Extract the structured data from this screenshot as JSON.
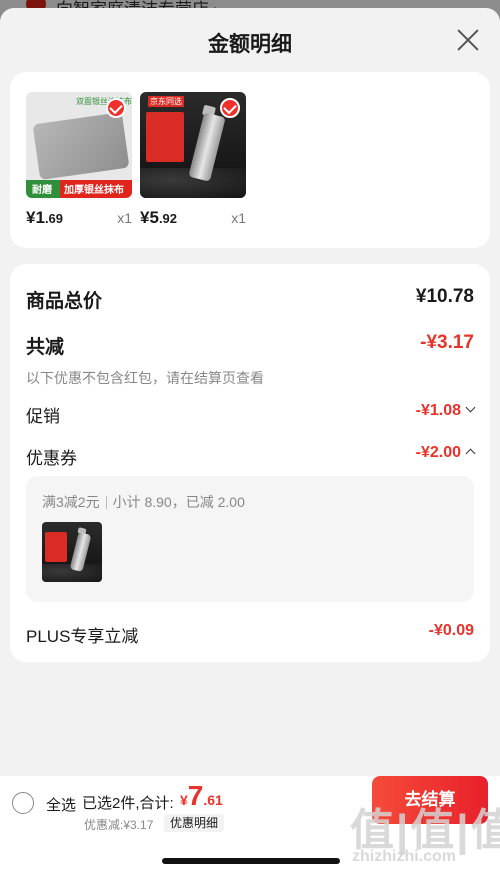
{
  "backdrop": {
    "shop_name": "向智家庭清洁专营店 ›"
  },
  "sheet": {
    "title": "金额明细",
    "close_icon": "close-icon"
  },
  "products": [
    {
      "thumb_tag_left": "耐磨",
      "thumb_tag_right": "加厚银丝抹布",
      "thumb_top_text": "双面银丝清洁布",
      "price_currency": "¥",
      "price_int": "1",
      "price_dec": ".69",
      "qty": "x1",
      "selected": true
    },
    {
      "thumb_top_tag": "京东同选",
      "price_currency": "¥",
      "price_int": "5",
      "price_dec": ".92",
      "qty": "x1",
      "selected": true
    }
  ],
  "summary": {
    "total_label": "商品总价",
    "total_value": "¥10.78",
    "reduce_label": "共减",
    "reduce_value": "-¥3.17",
    "note": "以下优惠不包含红包，请在结算页查看",
    "promo_label": "促销",
    "promo_value": "-¥1.08",
    "coupon_label": "优惠券",
    "coupon_value": "-¥2.00",
    "coupon_detail_rule": "满3减2元",
    "coupon_detail_sub": "小计 8.90，已减 2.00",
    "plus_label": "PLUS专享立减",
    "plus_value": "-¥0.09"
  },
  "bottom": {
    "select_all": "全选",
    "selected_info": "已选2件,合计:",
    "total_currency": "¥",
    "total_int": "7",
    "total_dec": ".61",
    "discount_info": "优惠减:¥3.17",
    "detail_button": "优惠明细",
    "checkout_button": "去结算",
    "watermark": "值|值|值",
    "watermark_url": "zhizhizhi.com"
  },
  "colors": {
    "accent": "#e8332a",
    "background": "#f2f2f2"
  }
}
